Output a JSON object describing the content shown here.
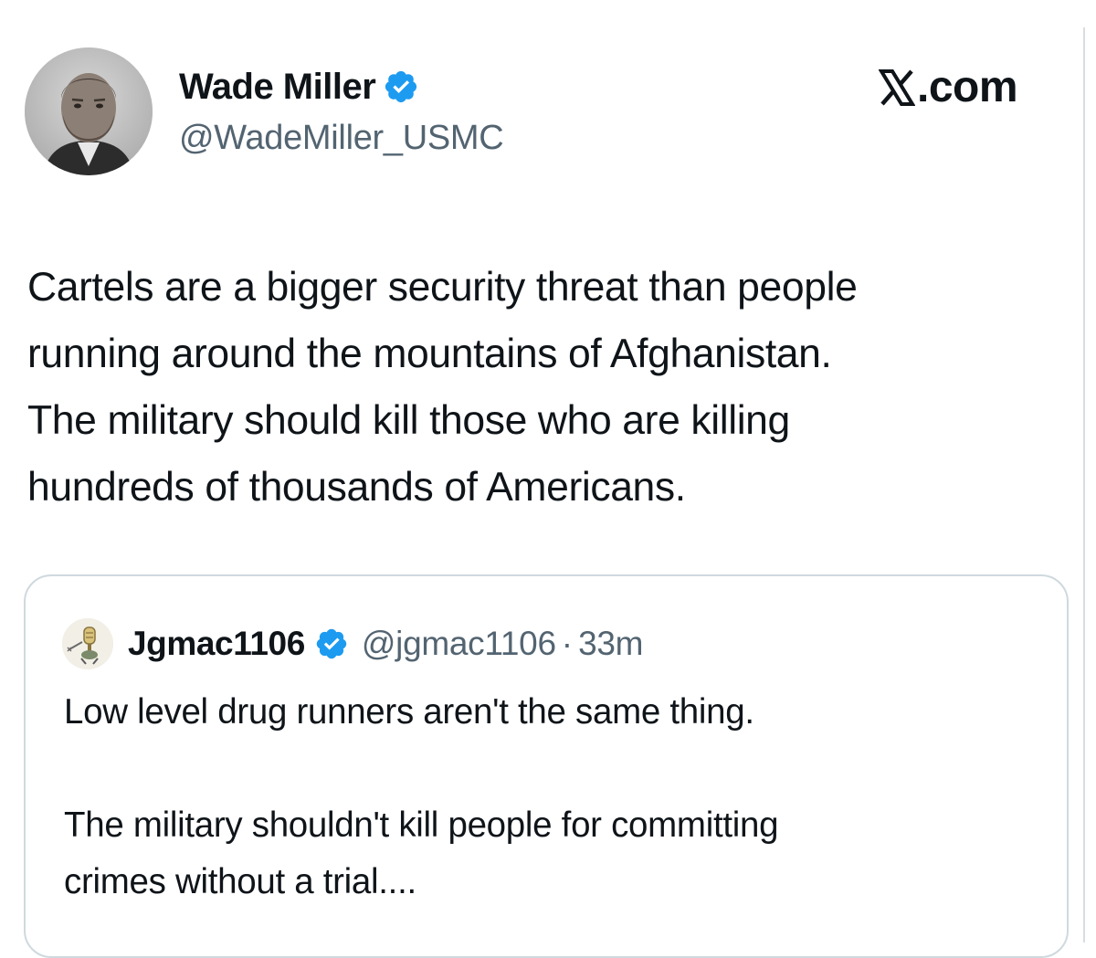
{
  "author": {
    "display_name": "Wade Miller",
    "handle": "@WadeMiller_USMC",
    "avatar_icon": "user-avatar-photo",
    "verified_icon": "verified-badge-icon",
    "verified_color": "#1d9bf0"
  },
  "site": {
    "logo_icon": "x-logo-icon",
    "domain_text": ".com"
  },
  "tweet": {
    "lines": [
      "Cartels are a bigger security threat than people",
      "running around the mountains of Afghanistan.",
      "The military should kill those who are killing",
      "hundreds of thousands of Americans."
    ]
  },
  "quoted_tweet": {
    "display_name": "Jgmac1106",
    "handle": "@jgmac1106",
    "separator": "·",
    "time": "33m",
    "avatar_icon": "quoted-user-avatar",
    "verified_icon": "verified-badge-icon",
    "paragraph_1": "Low level drug runners aren't the same thing.",
    "paragraph_2_lines": [
      "The military shouldn't kill people for committing",
      "crimes without a trial...."
    ]
  },
  "colors": {
    "text": "#0f1419",
    "secondary_text": "#536471",
    "border": "#cfd9de",
    "verified": "#1d9bf0"
  }
}
